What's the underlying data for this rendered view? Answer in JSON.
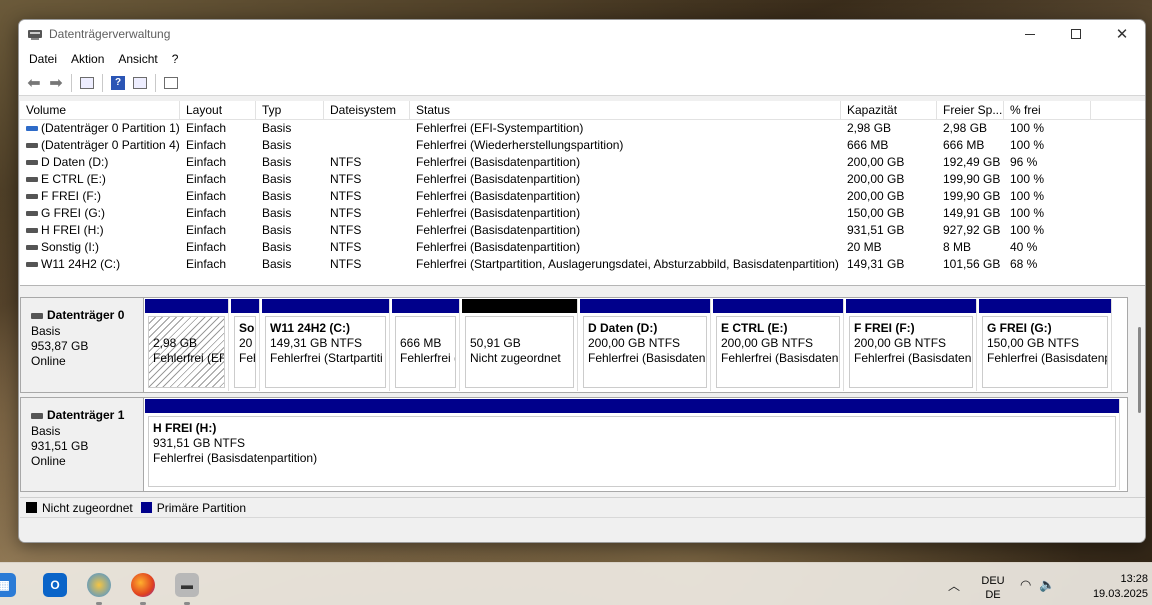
{
  "window": {
    "title": "Datenträgerverwaltung"
  },
  "menu": [
    "Datei",
    "Aktion",
    "Ansicht",
    "?"
  ],
  "columns": [
    "Volume",
    "Layout",
    "Typ",
    "Dateisystem",
    "Status",
    "Kapazität",
    "Freier Sp...",
    "% frei"
  ],
  "volumes": [
    {
      "volume": "(Datenträger 0 Partition 1)",
      "layout": "Einfach",
      "typ": "Basis",
      "fs": "",
      "status": "Fehlerfrei (EFI-Systempartition)",
      "kap": "2,98 GB",
      "frei": "2,98 GB",
      "pct": "100 %"
    },
    {
      "volume": "(Datenträger 0 Partition 4)",
      "layout": "Einfach",
      "typ": "Basis",
      "fs": "",
      "status": "Fehlerfrei (Wiederherstellungspartition)",
      "kap": "666 MB",
      "frei": "666 MB",
      "pct": "100 %"
    },
    {
      "volume": "D Daten (D:)",
      "layout": "Einfach",
      "typ": "Basis",
      "fs": "NTFS",
      "status": "Fehlerfrei (Basisdatenpartition)",
      "kap": "200,00 GB",
      "frei": "192,49 GB",
      "pct": "96 %"
    },
    {
      "volume": "E CTRL (E:)",
      "layout": "Einfach",
      "typ": "Basis",
      "fs": "NTFS",
      "status": "Fehlerfrei (Basisdatenpartition)",
      "kap": "200,00 GB",
      "frei": "199,90 GB",
      "pct": "100 %"
    },
    {
      "volume": "F FREI (F:)",
      "layout": "Einfach",
      "typ": "Basis",
      "fs": "NTFS",
      "status": "Fehlerfrei (Basisdatenpartition)",
      "kap": "200,00 GB",
      "frei": "199,90 GB",
      "pct": "100 %"
    },
    {
      "volume": "G FREI (G:)",
      "layout": "Einfach",
      "typ": "Basis",
      "fs": "NTFS",
      "status": "Fehlerfrei (Basisdatenpartition)",
      "kap": "150,00 GB",
      "frei": "149,91 GB",
      "pct": "100 %"
    },
    {
      "volume": "H FREI (H:)",
      "layout": "Einfach",
      "typ": "Basis",
      "fs": "NTFS",
      "status": "Fehlerfrei (Basisdatenpartition)",
      "kap": "931,51 GB",
      "frei": "927,92 GB",
      "pct": "100 %"
    },
    {
      "volume": "Sonstig (I:)",
      "layout": "Einfach",
      "typ": "Basis",
      "fs": "NTFS",
      "status": "Fehlerfrei (Basisdatenpartition)",
      "kap": "20 MB",
      "frei": "8 MB",
      "pct": "40 %"
    },
    {
      "volume": "W11 24H2 (C:)",
      "layout": "Einfach",
      "typ": "Basis",
      "fs": "NTFS",
      "status": "Fehlerfrei (Startpartition, Auslagerungsdatei, Absturzabbild, Basisdatenpartition)",
      "kap": "149,31 GB",
      "frei": "101,56 GB",
      "pct": "68 %"
    }
  ],
  "disks": [
    {
      "name": "Datenträger 0",
      "type": "Basis",
      "size": "953,87 GB",
      "state": "Online",
      "partitions": [
        {
          "name": "",
          "size": "2,98 GB",
          "status": "Fehlerfrei (EFI",
          "style": "hatch"
        },
        {
          "name": "Sor",
          "size": "20 I",
          "status": "Feh",
          "style": "primary"
        },
        {
          "name": "W11 24H2  (C:)",
          "size": "149,31 GB NTFS",
          "status": "Fehlerfrei (Startpartiti",
          "style": "primary"
        },
        {
          "name": "",
          "size": "666 MB",
          "status": "Fehlerfrei (",
          "style": "primary"
        },
        {
          "name": "",
          "size": "50,91 GB",
          "status": "Nicht zugeordnet",
          "style": "unalloc"
        },
        {
          "name": "D Daten  (D:)",
          "size": "200,00 GB NTFS",
          "status": "Fehlerfrei (Basisdatenp",
          "style": "primary"
        },
        {
          "name": "E CTRL  (E:)",
          "size": "200,00 GB NTFS",
          "status": "Fehlerfrei (Basisdatenp",
          "style": "primary"
        },
        {
          "name": "F FREI  (F:)",
          "size": "200,00 GB NTFS",
          "status": "Fehlerfrei (Basisdatenp",
          "style": "primary"
        },
        {
          "name": "G FREI  (G:)",
          "size": "150,00 GB NTFS",
          "status": "Fehlerfrei (Basisdatenpa",
          "style": "primary"
        }
      ]
    },
    {
      "name": "Datenträger 1",
      "type": "Basis",
      "size": "931,51 GB",
      "state": "Online",
      "partitions": [
        {
          "name": "H FREI  (H:)",
          "size": "931,51 GB NTFS",
          "status": "Fehlerfrei (Basisdatenpartition)",
          "style": "primary"
        }
      ]
    }
  ],
  "legend": {
    "unalloc": "Nicht zugeordnet",
    "primary": "Primäre Partition",
    "unalloc_color": "#000000",
    "primary_color": "#00008b"
  },
  "taskbar": {
    "lang1": "DEU",
    "lang2": "DE",
    "time": "13:28",
    "date": "19.03.2025"
  }
}
